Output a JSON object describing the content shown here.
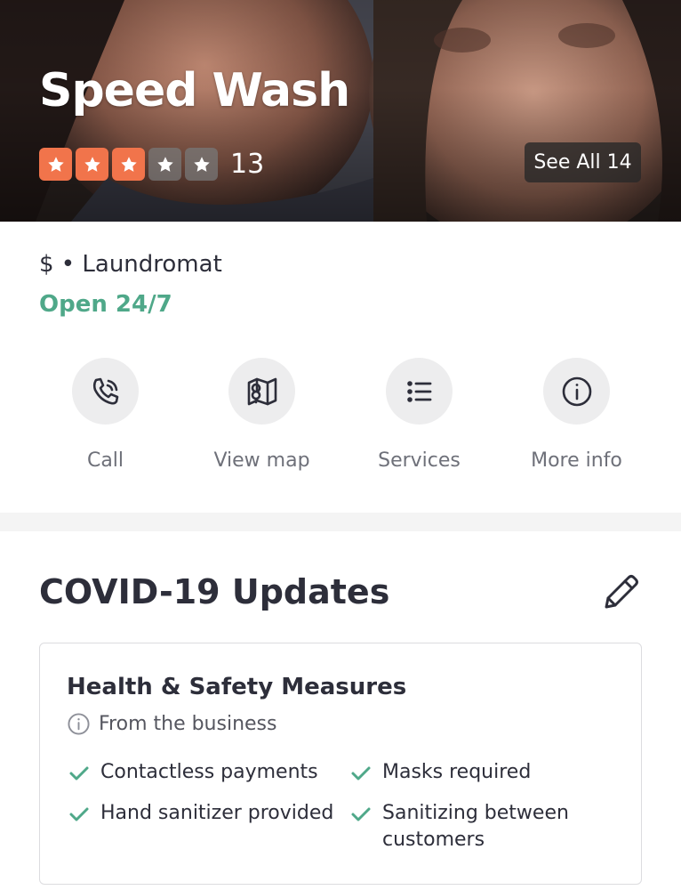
{
  "business": {
    "name": "Speed Wash",
    "rating": 3,
    "rating_max": 5,
    "review_count": "13",
    "see_all_label": "See All 14",
    "category": "$ • Laundromat",
    "hours_status": "Open 24/7"
  },
  "actions": [
    {
      "label": "Call",
      "icon": "phone-icon"
    },
    {
      "label": "View map",
      "icon": "map-icon"
    },
    {
      "label": "Services",
      "icon": "list-icon"
    },
    {
      "label": "More info",
      "icon": "info-icon"
    }
  ],
  "covid": {
    "title": "COVID-19 Updates",
    "card": {
      "title": "Health & Safety Measures",
      "source": "From the business",
      "measures": [
        "Contactless payments",
        "Masks required",
        "Hand sanitizer provided",
        "Sanitizing between customers"
      ]
    }
  },
  "colors": {
    "star_on": "#f1744b",
    "open_green": "#4fa889",
    "check_green": "#4fa889",
    "text_dark": "#2d2e3a"
  }
}
